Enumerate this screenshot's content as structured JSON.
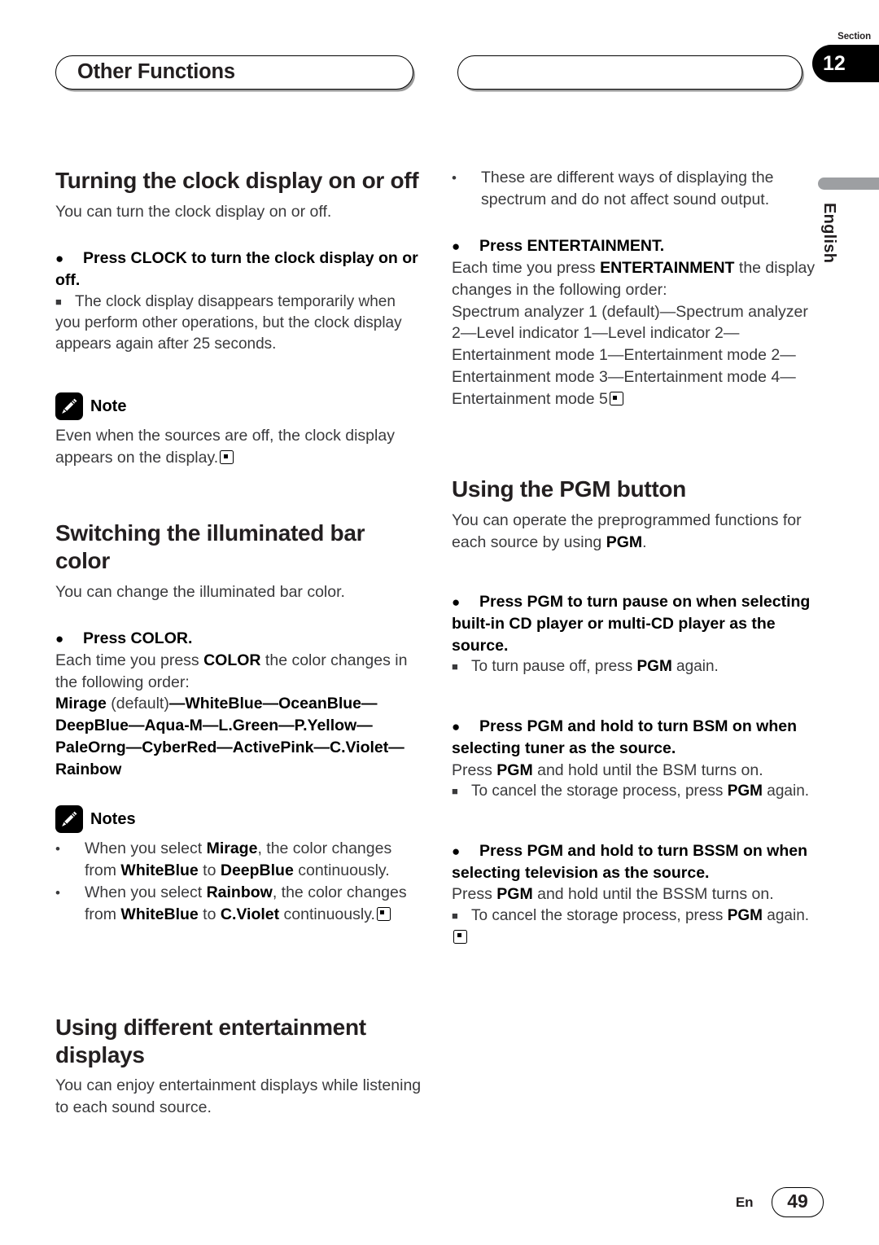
{
  "header": {
    "chapter_title": "Other Functions",
    "section_label": "Section",
    "section_number": "12"
  },
  "side_tab": {
    "language": "English"
  },
  "footer": {
    "lang_code": "En",
    "page_number": "49"
  },
  "left_column": {
    "clock": {
      "title": "Turning the clock display on or off",
      "intro": "You can turn the clock display on or off.",
      "bullet": "●",
      "step": "Press CLOCK to turn the clock display on or off.",
      "square": "■",
      "subnote": "The clock display disappears temporarily when you perform other operations, but the clock display appears again after 25 seconds.",
      "note_title": "Note",
      "note_body_1": "Even when the sources are off, the clock display",
      "note_body_2": "appears on the display."
    },
    "color": {
      "title": "Switching the illuminated bar color",
      "intro": "You can change the illuminated bar color.",
      "bullet": "●",
      "step": "Press COLOR.",
      "body_pre": "Each time you press ",
      "body_bold": "COLOR",
      "body_post": " the color changes in the following order:",
      "sequence_line_1_bold": "Mirage",
      "sequence_line_1_plain": " (default)",
      "sequence_rest": "—WhiteBlue—OceanBlue—DeepBlue—Aqua-M—L.Green—P.Yellow—PaleOrng—CyberRed—ActivePink—C.Violet—Rainbow",
      "notes_title": "Notes",
      "notes": [
        {
          "bullet": "•",
          "p1": "When you select ",
          "b1": "Mirage",
          "p2": ", the color changes from ",
          "b2": "WhiteBlue",
          "p3": " to ",
          "b3": "DeepBlue",
          "p4": " continuously."
        },
        {
          "bullet": "•",
          "p1": "When you select ",
          "b1": "Rainbow",
          "p2": ", the color changes from ",
          "b2": "WhiteBlue",
          "p3": " to ",
          "b3": "C.Violet",
          "p4": " continuously."
        }
      ]
    },
    "entertainment": {
      "title": "Using different entertainment displays",
      "intro": "You can enjoy entertainment displays while listening to each sound source."
    }
  },
  "right_column": {
    "entertainment": {
      "bullet_small": "•",
      "lead_note": "These are different ways of displaying the spectrum and do not affect sound output.",
      "bullet": "●",
      "step": "Press ENTERTAINMENT.",
      "body_pre": "Each time you press ",
      "body_bold": "ENTERTAINMENT",
      "body_post": " the display changes in the following order:",
      "sequence": "Spectrum analyzer 1 (default)—Spectrum analyzer 2—Level indicator 1—Level indicator 2—Entertainment mode 1—Entertainment mode 2—Entertainment mode 3—Entertainment mode 4—Entertainment mode 5"
    },
    "pgm": {
      "title": "Using the PGM button",
      "intro_pre": "You can operate the preprogrammed functions for each source by using ",
      "intro_bold": "PGM",
      "intro_post": ".",
      "items": [
        {
          "bullet": "●",
          "step": "Press PGM to turn pause on when selecting built-in CD player or multi-CD player as the source.",
          "square": "■",
          "sub_pre": "To turn pause off, press ",
          "sub_bold": "PGM",
          "sub_post": " again."
        },
        {
          "bullet": "●",
          "step": "Press PGM and hold to turn BSM on when selecting tuner as the source.",
          "body_pre": "Press ",
          "body_bold": "PGM",
          "body_post": " and hold until the BSM turns on.",
          "square": "■",
          "sub_pre": "To cancel the storage process, press ",
          "sub_bold": "PGM",
          "sub_post": " again."
        },
        {
          "bullet": "●",
          "step": "Press PGM and hold to turn BSSM on when selecting television as the source.",
          "body_pre": "Press ",
          "body_bold": "PGM",
          "body_post": " and hold until the BSSM turns on.",
          "square": "■",
          "sub_pre": "To cancel the storage process, press ",
          "sub_bold": "PGM",
          "sub_post": " again."
        }
      ]
    }
  }
}
